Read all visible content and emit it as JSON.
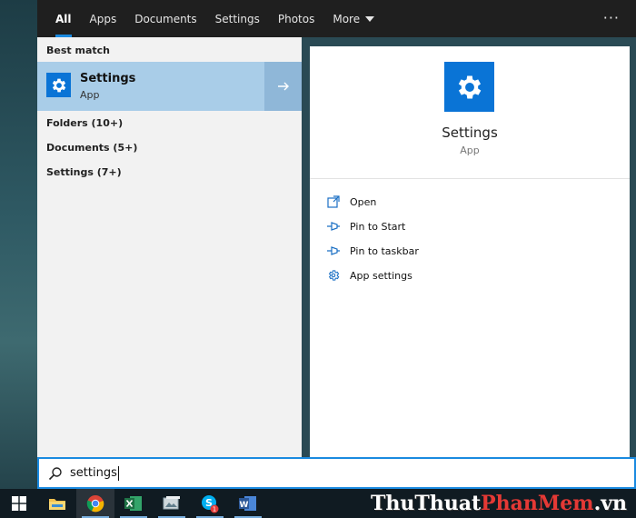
{
  "nav": {
    "tabs": [
      {
        "label": "All"
      },
      {
        "label": "Apps"
      },
      {
        "label": "Documents"
      },
      {
        "label": "Settings"
      },
      {
        "label": "Photos"
      },
      {
        "label": "More"
      }
    ],
    "ellipsis": "···"
  },
  "left": {
    "best_match_label": "Best match",
    "best_match": {
      "name": "Settings",
      "type": "App"
    },
    "categories": [
      "Folders (10+)",
      "Documents (5+)",
      "Settings (7+)"
    ]
  },
  "preview": {
    "title": "Settings",
    "subtitle": "App",
    "actions": [
      {
        "label": "Open",
        "icon": "open-icon"
      },
      {
        "label": "Pin to Start",
        "icon": "pin-icon"
      },
      {
        "label": "Pin to taskbar",
        "icon": "pin-icon"
      },
      {
        "label": "App settings",
        "icon": "gear-icon"
      }
    ]
  },
  "search": {
    "value": "settings"
  },
  "taskbar": {
    "items": [
      "windows-start-icon",
      "file-explorer-icon",
      "chrome-icon",
      "excel-icon",
      "image-viewer-icon",
      "skype-icon",
      "word-icon"
    ],
    "skype_badge": "1"
  },
  "watermark": {
    "part1": "ThuThuat",
    "part2": "PhanMem",
    "part3": ".vn"
  },
  "colors": {
    "accent": "#1a8ae0",
    "tile": "#0a74d6",
    "selected": "#a9cde8",
    "excel": "#1e7145",
    "word": "#2b5797"
  }
}
